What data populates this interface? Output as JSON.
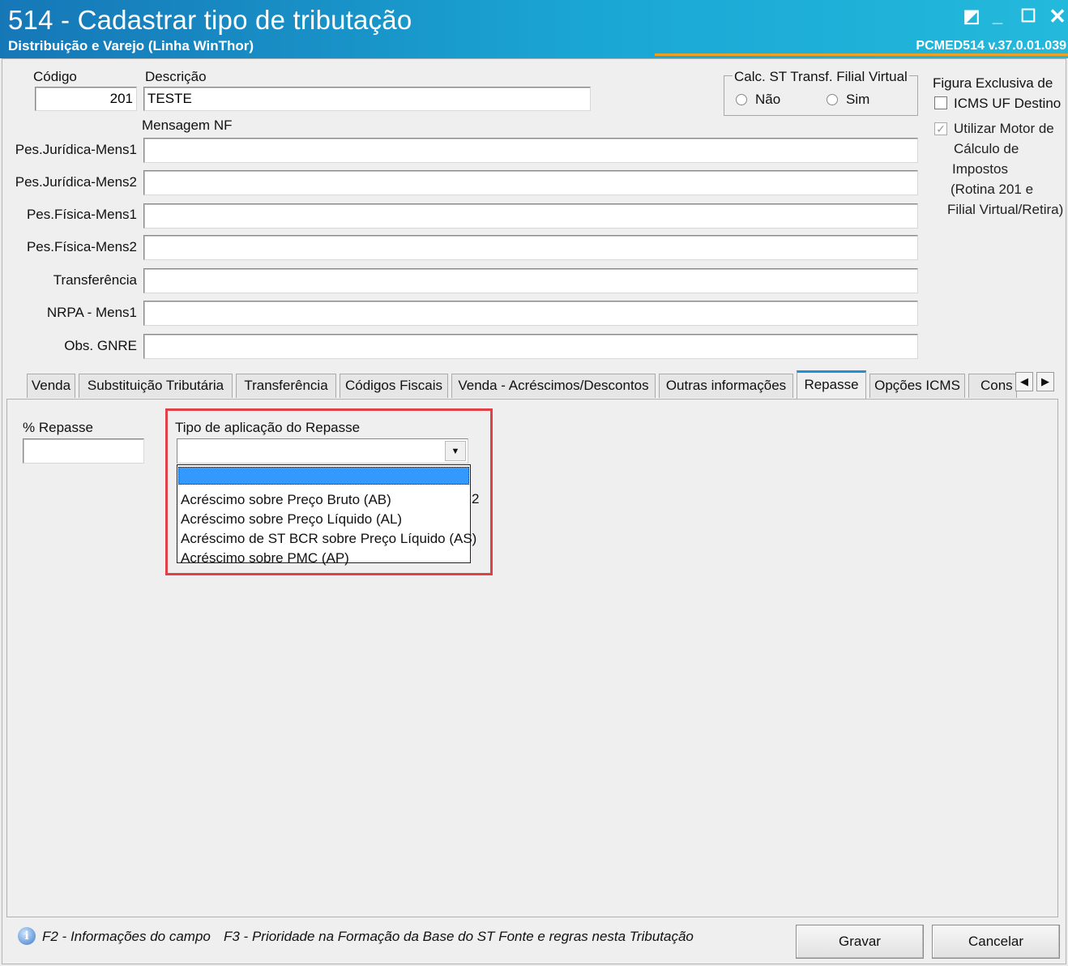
{
  "window": {
    "title": "514 - Cadastrar tipo de tributação",
    "subtitle": "Distribuição e Varejo (Linha WinThor)",
    "version": "PCMED514  v.37.0.01.039"
  },
  "header": {
    "codigo_label": "Código",
    "codigo_value": "201",
    "descricao_label": "Descrição",
    "descricao_value": "TESTE",
    "mensagem_nf_label": "Mensagem NF"
  },
  "calc_st": {
    "legend": "Calc. ST Transf. Filial Virtual",
    "nao_label": "Não",
    "sim_label": "Sim"
  },
  "figura": {
    "title": "Figura Exclusiva de",
    "icms_label": "ICMS UF Destino",
    "motor_lines": [
      "Utilizar Motor de",
      "Cálculo de",
      "Impostos",
      "(Rotina 201 e",
      "Filial Virtual/Retira)"
    ]
  },
  "messages": [
    {
      "label": "Pes.Jurídica-Mens1",
      "value": ""
    },
    {
      "label": "Pes.Jurídica-Mens2",
      "value": ""
    },
    {
      "label": "Pes.Física-Mens1",
      "value": ""
    },
    {
      "label": "Pes.Física-Mens2",
      "value": ""
    },
    {
      "label": "Transferência",
      "value": ""
    },
    {
      "label": "NRPA - Mens1",
      "value": ""
    },
    {
      "label": "Obs. GNRE",
      "value": ""
    }
  ],
  "tabs": [
    "Venda",
    "Substituição Tributária",
    "Transferência",
    "Códigos Fiscais",
    "Venda - Acréscimos/Descontos",
    "Outras informações",
    "Repasse",
    "Opções ICMS",
    "Cons"
  ],
  "active_tab": "Repasse",
  "repasse": {
    "pct_label": "% Repasse",
    "pct_value": "",
    "tipo_label": "Tipo de aplicação do Repasse",
    "tipo_value": "",
    "options": [
      "",
      "Acréscimo sobre Preço Bruto (AB)",
      "Acréscimo sobre Preço Líquido (AL)",
      "Acréscimo de ST BCR sobre Preço Líquido (AS)",
      "Acréscimo sobre PMC (AP)"
    ],
    "obscured_fragment": "2"
  },
  "footer": {
    "f2": "F2 - Informações do campo",
    "f3": "F3 - Prioridade na Formação da Base do ST Fonte e regras nesta Tributação",
    "gravar": "Gravar",
    "cancelar": "Cancelar"
  },
  "colors": {
    "title_bar": "#1a96cc",
    "highlight": "#e04048",
    "selection": "#3399ff",
    "active_tab_accent": "#1f8fd6"
  }
}
